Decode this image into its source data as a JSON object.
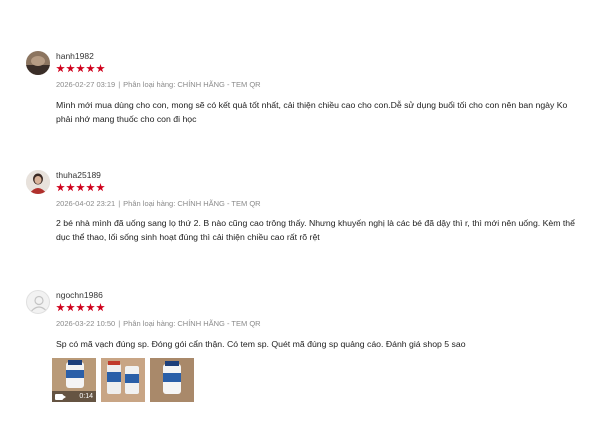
{
  "colors": {
    "star": "#d0011b",
    "meta": "#8a8a8a",
    "text": "#222222"
  },
  "reviews": [
    {
      "username": "hanh1982",
      "rating": 5,
      "date": "2026-02-27 03:19",
      "variation": "Phân loại hàng: CHÍNH HÃNG - TEM QR",
      "content": "Mình mới mua dùng cho con, mong sẽ có kết quả tốt nhất, cải thiện chiều cao cho con.Dễ sử dụng buổi tối cho con nên ban ngày Ko phải nhớ mang thuốc cho con đi học"
    },
    {
      "username": "thuha25189",
      "rating": 5,
      "date": "2026-04-02 23:21",
      "variation": "Phân loại hàng: CHÍNH HÃNG - TEM QR",
      "content": "2 bé nhà mình đã uống sang lọ thứ 2. B nào cũng cao trông thấy. Nhưng khuyến nghị là các bé đã dậy thì r, thì mới nên uống. Kèm thể dục thể thao, lối sống sinh hoạt đúng thì cải thiện chiều cao rất rõ rệt"
    },
    {
      "username": "ngochn1986",
      "rating": 5,
      "date": "2026-03-22 10:50",
      "variation": "Phân loại hàng: CHÍNH HÃNG - TEM QR",
      "content": "Sp có mã vạch đúng sp. Đóng gói cẩn thận. Có tem sp. Quét mã đúng sp quảng cáo. Đánh giá shop 5 sao",
      "video_duration": "0:14"
    }
  ],
  "separator": "|"
}
